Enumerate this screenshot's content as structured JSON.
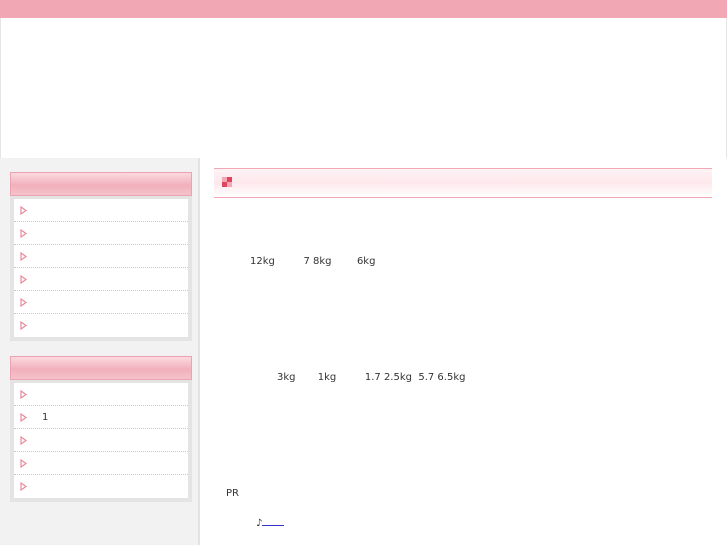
{
  "colors": {
    "top_bar": "#f1a8b4",
    "sidebar_bg": "#f2f2f2",
    "box_header": "#f2b0bb",
    "title_rule": "#f1a8b4",
    "link": "#3333cc"
  },
  "sidebar": {
    "box1": {
      "title": "",
      "items": [
        {
          "label": "",
          "icon": "arrow-icon"
        },
        {
          "label": "",
          "icon": "arrow-icon"
        },
        {
          "label": "",
          "icon": "arrow-icon"
        },
        {
          "label": "",
          "icon": "arrow-icon"
        },
        {
          "label": "",
          "icon": "arrow-icon"
        },
        {
          "label": "",
          "icon": "arrow-icon"
        }
      ]
    },
    "box2": {
      "title": "",
      "items": [
        {
          "label": "",
          "icon": "arrow-icon"
        },
        {
          "label": "1",
          "icon": "arrow-icon"
        },
        {
          "label": "",
          "icon": "arrow-icon"
        },
        {
          "label": "",
          "icon": "arrow-icon"
        },
        {
          "label": "",
          "icon": "arrow-icon"
        }
      ]
    }
  },
  "main": {
    "title": "",
    "title_icon": "pink-squares-icon",
    "line1": "12kg         7 8kg        6kg",
    "line2": "3kg       1kg         1.7 2.5kg  5.7 6.5kg",
    "line3": "PR",
    "line4_prefix": "♪"
  }
}
